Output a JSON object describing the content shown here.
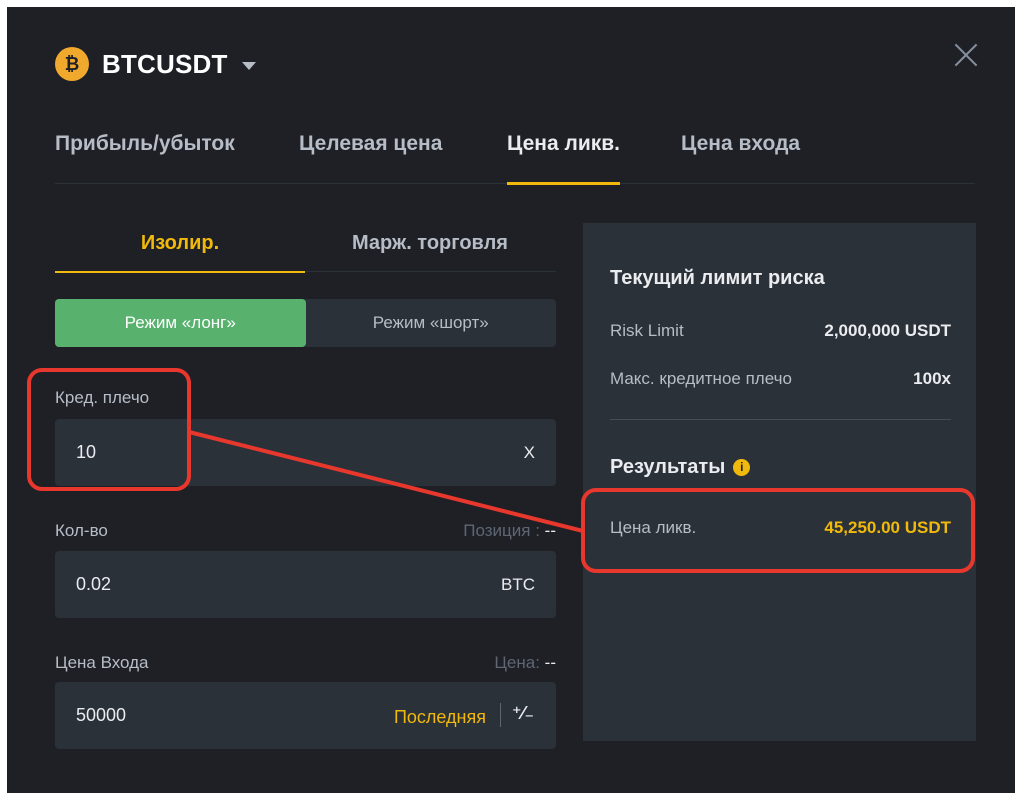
{
  "header": {
    "coin_glyph": "₿",
    "symbol": "BTCUSDT"
  },
  "tabs": [
    {
      "label": "Прибыль/убыток"
    },
    {
      "label": "Целевая цена"
    },
    {
      "label": "Цена ликв.",
      "active": true
    },
    {
      "label": "Цена входа"
    }
  ],
  "subtabs": [
    {
      "label": "Изолир.",
      "active": true
    },
    {
      "label": "Марж. торговля"
    }
  ],
  "mode": {
    "long_label": "Режим «лонг»",
    "short_label": "Режим «шорт»"
  },
  "leverage": {
    "label": "Кред. плечо",
    "value": "10",
    "unit": "X"
  },
  "quantity": {
    "label": "Кол-во",
    "hint_label": "Позиция :",
    "hint_value": "--",
    "value": "0.02",
    "unit": "BTC"
  },
  "entry": {
    "label": "Цена Входа",
    "hint_label": "Цена:",
    "hint_value": "--",
    "value": "50000",
    "last_label": "Последняя",
    "swap_glyph": "⁺⁄₋"
  },
  "risk": {
    "title": "Текущий лимит риска",
    "rows": [
      {
        "key": "Risk Limit",
        "value": "2,000,000 USDT"
      },
      {
        "key": "Макс. кредитное плечо",
        "value": "100x"
      }
    ]
  },
  "results": {
    "title": "Результаты",
    "info_glyph": "i",
    "liq_label": "Цена ликв.",
    "liq_value": "45,250.00 USDT"
  },
  "colors": {
    "background": "#1e2026",
    "card": "#2b3139",
    "accent": "#f0b90b",
    "long": "#58b26d",
    "annotation": "#e8372c"
  }
}
